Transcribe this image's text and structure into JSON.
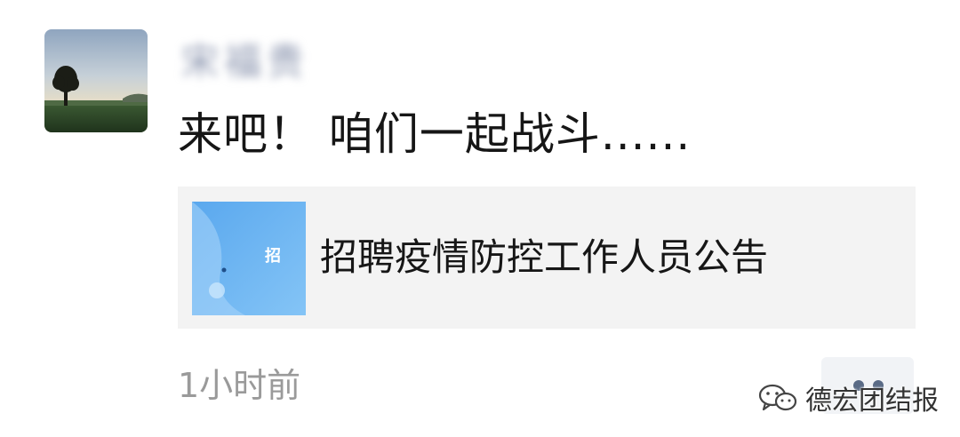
{
  "post": {
    "author_name": "宋福贵",
    "text": "来吧！ 咱们一起战斗......",
    "timestamp": "1小时前"
  },
  "link_card": {
    "thumbnail_text": "招",
    "title": "招聘疫情防控工作人员公告"
  },
  "watermark": {
    "text": "德宏团结报"
  },
  "icons": {
    "avatar": "landscape-tree-avatar",
    "more": "two-dot-more-icon",
    "watermark_logo": "wechat-logo-icon"
  },
  "colors": {
    "text_primary": "#161616",
    "text_secondary": "#9a9a9a",
    "card_background": "#f3f3f3",
    "thumbnail_blue": "#6eb6f0",
    "more_button_bg": "#f1f3f6",
    "more_dots": "#5a6b86"
  }
}
